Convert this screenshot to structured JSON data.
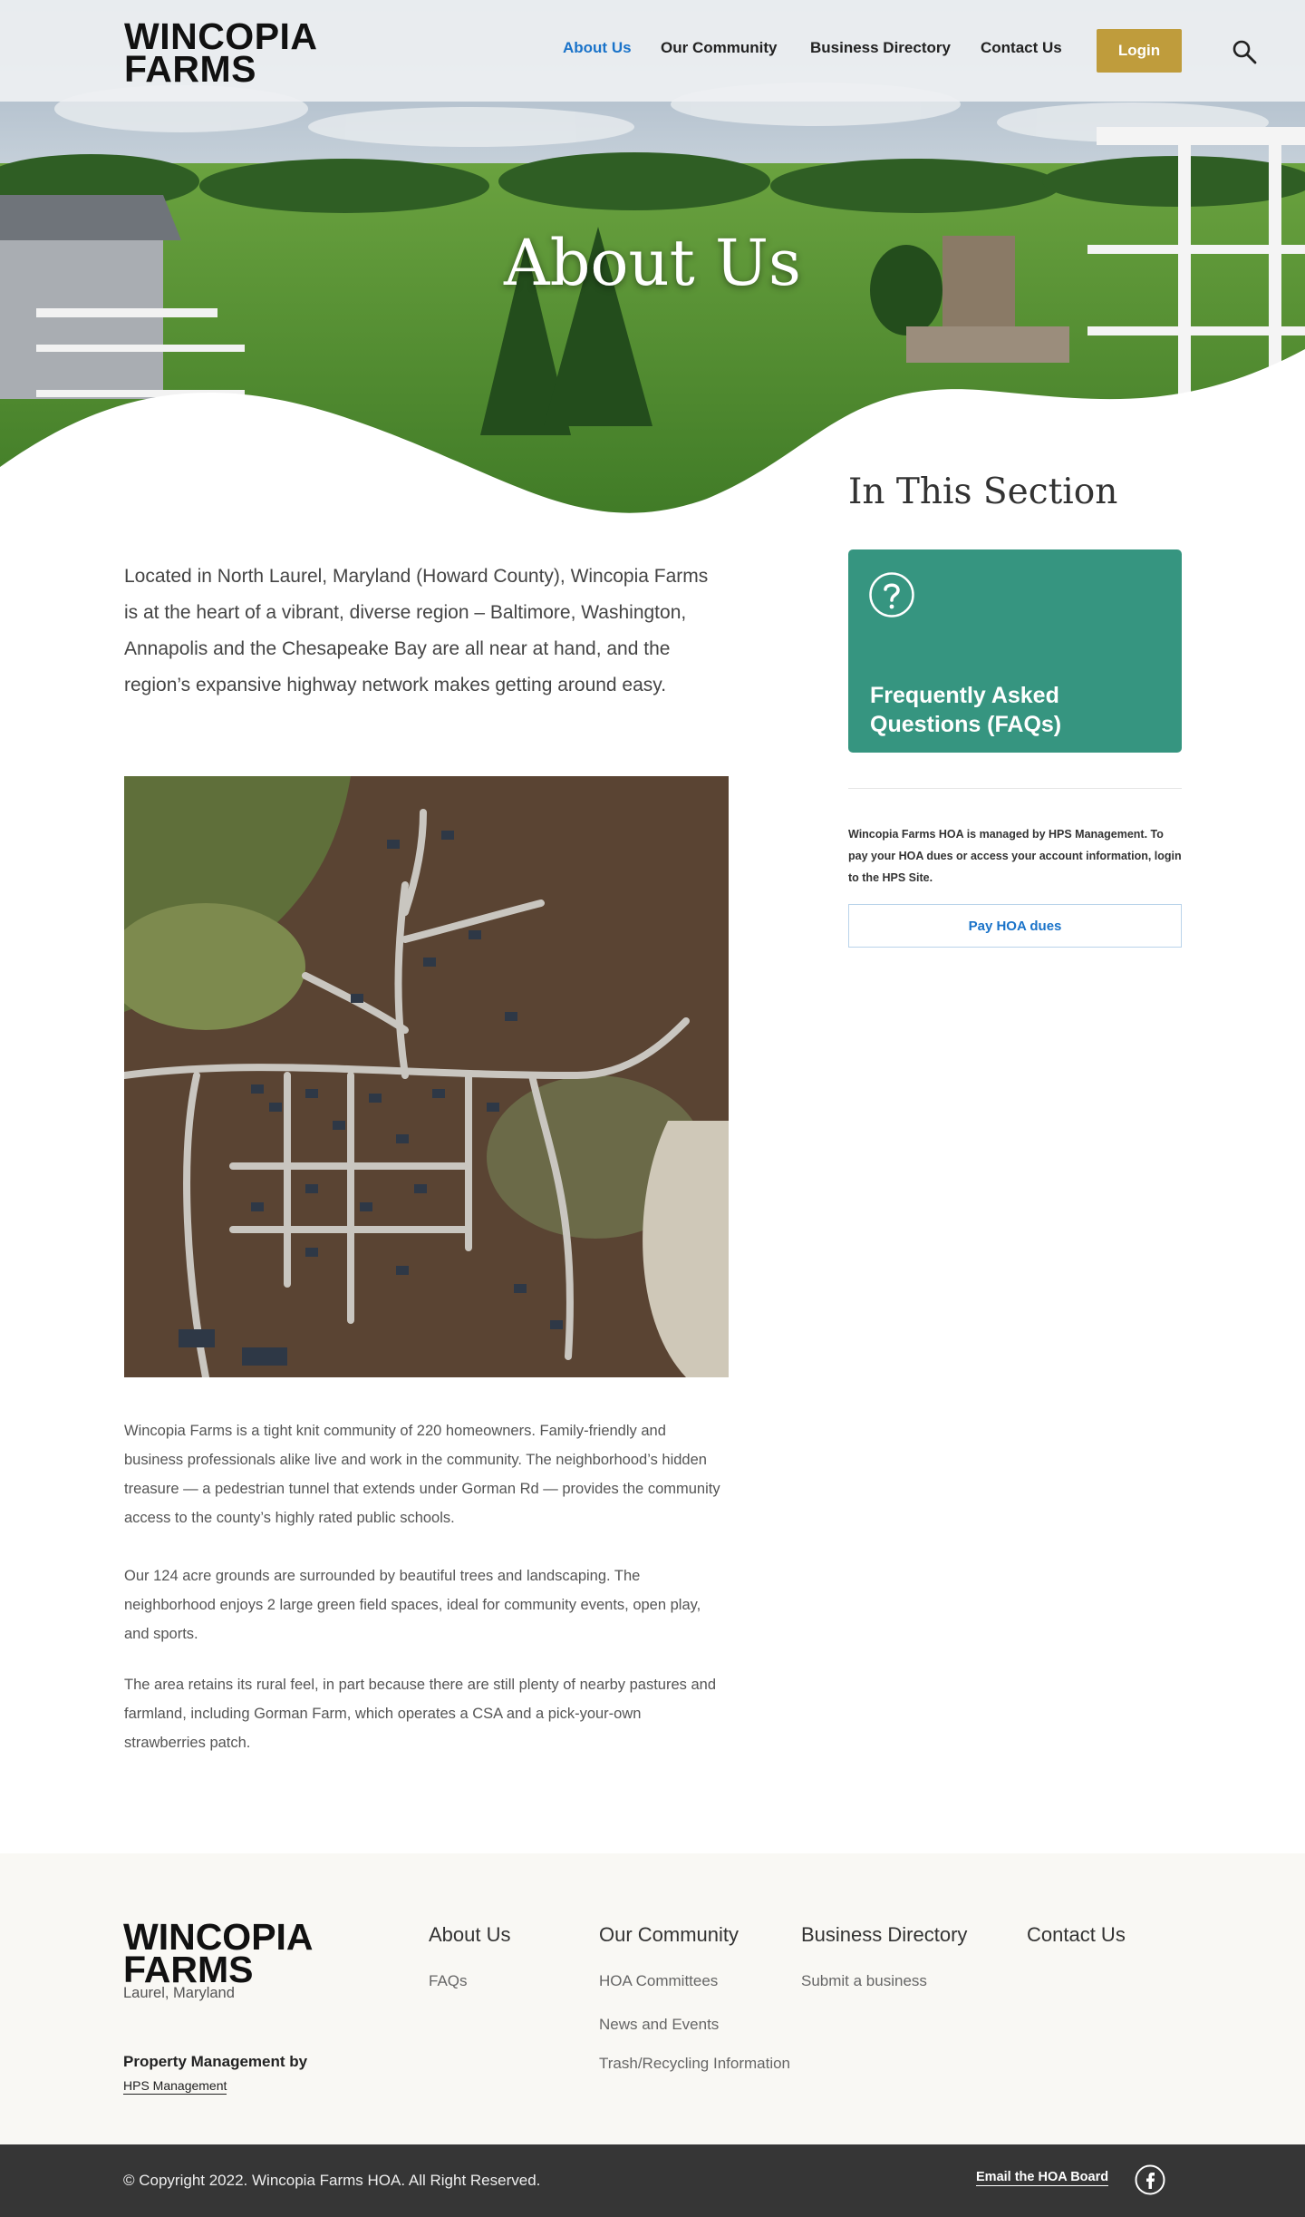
{
  "header": {
    "logo_line1": "WINCOPIA",
    "logo_line2": "FARMS",
    "nav": [
      {
        "label": "About Us",
        "active": true
      },
      {
        "label": "Our Community",
        "active": false
      },
      {
        "label": "Business Directory",
        "active": false
      },
      {
        "label": "Contact Us",
        "active": false
      }
    ],
    "login_label": "Login",
    "search_icon": "search-icon"
  },
  "hero": {
    "title": "About Us"
  },
  "main": {
    "intro": "Located in North Laurel, Maryland (Howard County), Wincopia Farms is at the heart of a vibrant, diverse region – Baltimore, Washington, Annapolis and the Chesapeake Bay are all near at hand, and the region’s expansive highway network makes getting around easy.",
    "paragraphs": [
      "Wincopia Farms is a tight knit community of 220 homeowners. Family-friendly and business professionals alike live and work in the community. The neighborhood’s hidden treasure — a pedestrian tunnel that extends under Gorman Rd — provides the community access to the county’s highly rated public schools.",
      "Our 124 acre grounds are surrounded by beautiful trees and landscaping. The neighborhood enjoys 2 large green field spaces, ideal for community events, open play, and sports.",
      "The area retains its rural feel, in part because there are still plenty of nearby pastures and farmland, including Gorman Farm, which operates a CSA and a pick-your-own strawberries patch."
    ]
  },
  "sidebar": {
    "title": "In This Section",
    "faq_card_label": "Frequently Asked Questions (FAQs)",
    "faq_icon": "question-circle-icon",
    "note": "Wincopia Farms HOA is managed by HPS Management. To pay your HOA dues or access your account information, login to the HPS Site.",
    "pay_button": "Pay HOA dues"
  },
  "footer": {
    "logo_line1": "WINCOPIA",
    "logo_line2": "FARMS",
    "location": "Laurel, Maryland",
    "pm_label": "Property Management by",
    "pm_link": "HPS Management",
    "columns": [
      {
        "heading": "About Us",
        "links": [
          "FAQs"
        ]
      },
      {
        "heading": "Our Community",
        "links": [
          "HOA Committees",
          "News and Events",
          "Trash/Recycling Information"
        ]
      },
      {
        "heading": "Business Directory",
        "links": [
          "Submit a business"
        ]
      },
      {
        "heading": "Contact Us",
        "links": []
      }
    ]
  },
  "bottom_bar": {
    "copyright": "© Copyright 2022. Wincopia Farms HOA. All Right Reserved.",
    "email_link": "Email the HOA Board",
    "social_icon": "facebook-icon"
  },
  "colors": {
    "accent_blue": "#1a73c9",
    "login_gold": "#bf9c3c",
    "faq_green": "#369580",
    "footer_bg": "#f9f8f4",
    "bottom_bar_bg": "#363636"
  }
}
